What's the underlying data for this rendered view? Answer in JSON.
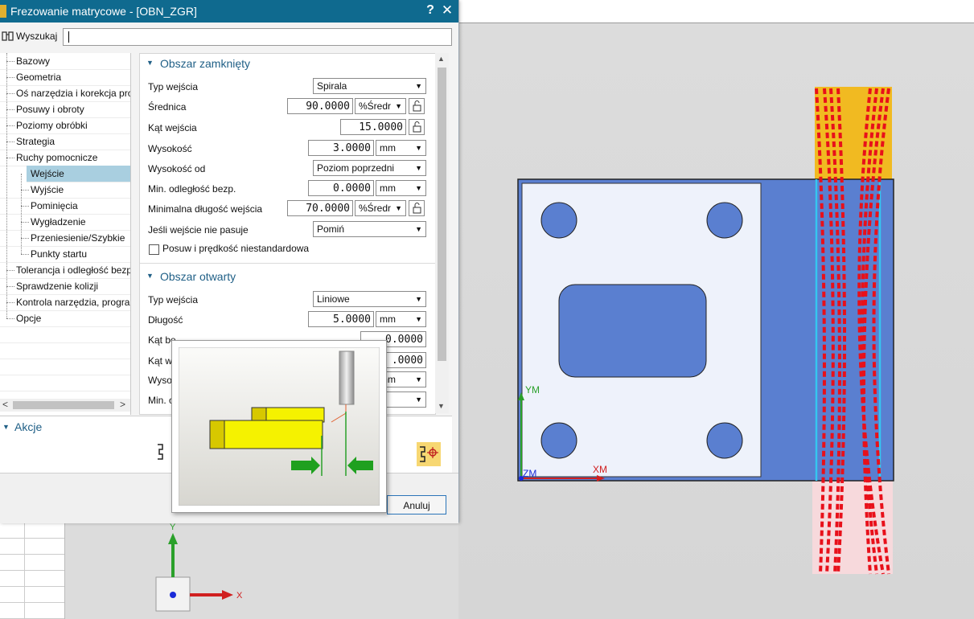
{
  "dialog": {
    "title": "Frezowanie matrycowe - [OBN_ZGR]",
    "help": "?",
    "close": "✕"
  },
  "search": {
    "label": "Wyszukaj",
    "value": ""
  },
  "tree": {
    "items": [
      {
        "label": "Bazowy"
      },
      {
        "label": "Geometria"
      },
      {
        "label": "Oś narzędzia i korekcja pro"
      },
      {
        "label": "Posuwy i obroty"
      },
      {
        "label": "Poziomy obróbki"
      },
      {
        "label": "Strategia"
      },
      {
        "label": "Ruchy pomocnicze"
      },
      {
        "label": "Wejście"
      },
      {
        "label": "Wyjście"
      },
      {
        "label": "Pominięcia"
      },
      {
        "label": "Wygładzenie"
      },
      {
        "label": "Przeniesienie/Szybkie"
      },
      {
        "label": "Punkty startu"
      },
      {
        "label": "Tolerancja i odległość bezp"
      },
      {
        "label": "Sprawdzenie kolizji"
      },
      {
        "label": "Kontrola narzędzia, prograr"
      },
      {
        "label": "Opcje"
      }
    ],
    "scroll_left": "<",
    "scroll_right": ">"
  },
  "closed_area": {
    "header": "Obszar zamknięty",
    "typ_wejscia": {
      "label": "Typ wejścia",
      "value": "Spirala"
    },
    "srednica": {
      "label": "Średnica",
      "value": "90.0000",
      "unit": "%Średr"
    },
    "kat_wejscia": {
      "label": "Kąt wejścia",
      "value": "15.0000"
    },
    "wysokosc": {
      "label": "Wysokość",
      "value": "3.0000",
      "unit": "mm"
    },
    "wysokosc_od": {
      "label": "Wysokość od",
      "value": "Poziom poprzedni"
    },
    "min_odl": {
      "label": "Min. odległość bezp.",
      "value": "0.0000",
      "unit": "mm"
    },
    "min_dl": {
      "label": "Minimalna długość wejścia",
      "value": "70.0000",
      "unit": "%Średr"
    },
    "jesli": {
      "label": "Jeśli wejście nie pasuje",
      "value": "Pomiń"
    },
    "posuw": {
      "label": "Posuw i prędkość niestandardowa",
      "checked": false
    }
  },
  "open_area": {
    "header": "Obszar otwarty",
    "typ_wejscia": {
      "label": "Typ wejścia",
      "value": "Liniowe"
    },
    "dlugosc": {
      "label": "Długość",
      "value": "5.0000",
      "unit": "mm"
    },
    "kat_b": {
      "label_visible": "Kąt be",
      "value_visible": "0.0000"
    },
    "kat_w": {
      "label_visible": "Kąt w",
      "value_visible": ".0000"
    },
    "wyso": {
      "label_visible": "Wyso",
      "unit_visible": "mm"
    },
    "min": {
      "label_visible": "Min. o"
    }
  },
  "actions": {
    "header": "Akcje"
  },
  "buttons": {
    "cancel": "Anuluj"
  },
  "viewport": {
    "axis_ym": "YM",
    "axis_xm": "XM",
    "axis_zm": "ZM",
    "triad_y": "Y",
    "triad_x": "X"
  },
  "colors": {
    "title_bar": "#0f6a8f",
    "part_face": "#5a7fd0",
    "part_inner": "#eef2fb",
    "toolpath": "#e8101a",
    "toolpath_top": "#f5b400",
    "selection": "#a9cfe0",
    "section_header": "#1f5f86"
  },
  "icons": [
    "lock-icon",
    "search-binoculars-icon",
    "triangle-down-icon",
    "action-generate-icon",
    "action-verify-icon",
    "axis-triad-icon"
  ]
}
